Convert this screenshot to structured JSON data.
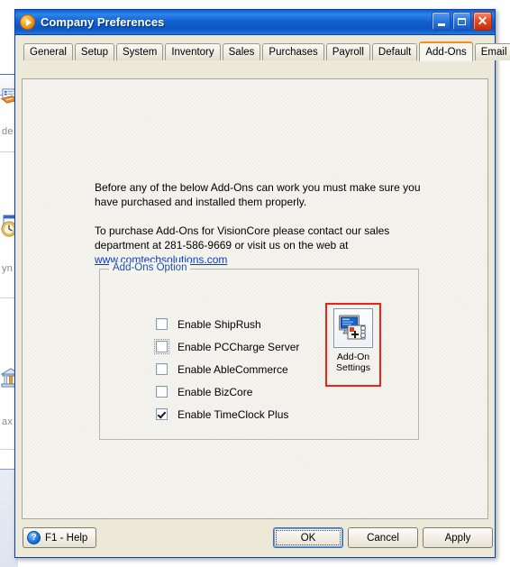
{
  "background": {
    "labels": [
      "de",
      "yn",
      "ax"
    ],
    "icons": [
      "phone-list-icon",
      "clock-calendar-icon",
      "bank-building-icon"
    ]
  },
  "window": {
    "title": "Company Preferences",
    "icon": "orange-play-circle-icon",
    "controls": {
      "minimize": "minimize-icon",
      "maximize": "maximize-icon",
      "close": "close-icon"
    }
  },
  "tabs": [
    {
      "label": "General",
      "active": false
    },
    {
      "label": "Setup",
      "active": false
    },
    {
      "label": "System",
      "active": false
    },
    {
      "label": "Inventory",
      "active": false
    },
    {
      "label": "Sales",
      "active": false
    },
    {
      "label": "Purchases",
      "active": false
    },
    {
      "label": "Payroll",
      "active": false
    },
    {
      "label": "Default",
      "active": false
    },
    {
      "label": "Add-Ons",
      "active": true
    },
    {
      "label": "Email Setup",
      "active": false
    }
  ],
  "content": {
    "paragraph1": "Before any of the below Add-Ons can work you must make sure you have purchased and installed them properly.",
    "paragraph2_prefix": "To purchase Add-Ons for VisionCore please contact our sales department at 281-586-9669 or visit us on the web at ",
    "link_text": "www.comtechsolutions.com",
    "groupbox": {
      "legend": "Add-Ons Option",
      "checkboxes": [
        {
          "label": "Enable ShipRush",
          "checked": false,
          "focused": false
        },
        {
          "label": "Enable PCCharge Server",
          "checked": false,
          "focused": true
        },
        {
          "label": "Enable AbleCommerce",
          "checked": false,
          "focused": false
        },
        {
          "label": "Enable BizCore",
          "checked": false,
          "focused": false
        },
        {
          "label": "Enable TimeClock Plus",
          "checked": true,
          "focused": false
        }
      ],
      "tool_button": {
        "label_line1": "Add-On",
        "label_line2": "Settings",
        "icon": "monitor-plugin-icon",
        "highlighted": true
      }
    }
  },
  "buttons": {
    "help": "F1 - Help",
    "help_icon": "question-mark-icon",
    "ok": "OK",
    "cancel": "Cancel",
    "apply": "Apply"
  },
  "colors": {
    "title_bar": "#1463d2",
    "active_tab_accent": "#f2921d",
    "link": "#0a3cc8",
    "legend": "#1b4fae",
    "highlight": "#f41f14",
    "panel": "#f6f5ef",
    "dialog_face": "#ece9d8"
  }
}
